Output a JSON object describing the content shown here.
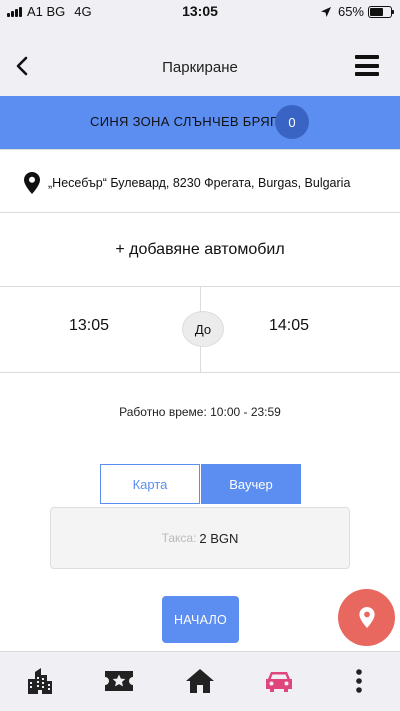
{
  "status_bar": {
    "carrier": "A1 BG",
    "network": "4G",
    "time": "13:05",
    "battery": "65%",
    "battery_level": 0.65
  },
  "nav": {
    "title": "Паркиране",
    "back_icon": "chevron-left-icon",
    "menu_icon": "hamburger-menu-icon"
  },
  "zone": {
    "name": "СИНЯ ЗОНА СЛЪНЧЕВ БРЯГ",
    "count": "0"
  },
  "address": {
    "icon": "map-pin-icon",
    "text": "„Несебър“ Булевард, 8230 Фрегата, Burgas, Bulgaria"
  },
  "add_car": {
    "label": "+ добавяне автомобил"
  },
  "time": {
    "from": "13:05",
    "to_label": "До",
    "to": "14:05"
  },
  "working_hours": "Работно време: 10:00 - 23:59",
  "payment_tabs": {
    "card": "Карта",
    "voucher": "Ваучер",
    "selected": "voucher"
  },
  "fee": {
    "label": "Такса:",
    "value": "2 BGN"
  },
  "start_button": "НАЧАЛО",
  "fab_icon": "location-pin-icon",
  "tab_bar": {
    "items": [
      {
        "icon": "buildings-icon",
        "active": false
      },
      {
        "icon": "ticket-star-icon",
        "active": false
      },
      {
        "icon": "home-icon",
        "active": false
      },
      {
        "icon": "car-icon",
        "active": true
      },
      {
        "icon": "more-vertical-icon",
        "active": false
      }
    ]
  },
  "colors": {
    "accent": "#5b8ef0",
    "accent_dark": "#3a64c4",
    "active_tab": "#e0457b",
    "fab": "#e8675e",
    "bar_bg": "#efeff4"
  }
}
